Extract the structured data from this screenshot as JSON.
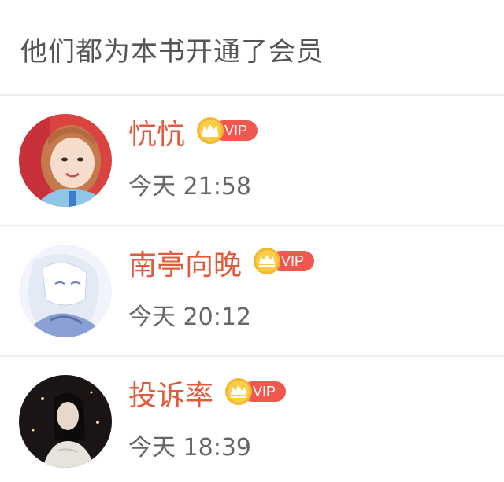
{
  "header": {
    "title": "他们都为本书开通了会员"
  },
  "members": [
    {
      "name": "忼忼",
      "badge": "VIP",
      "time": "今天 21:58"
    },
    {
      "name": "南亭向晚",
      "badge": "VIP",
      "time": "今天 20:12"
    },
    {
      "name": "投诉率",
      "badge": "VIP",
      "time": "今天 18:39"
    }
  ],
  "colors": {
    "name": "#e25a3c",
    "vip_pill": "#f0584f",
    "crown": "#f5b731",
    "divider": "#eeeeee"
  },
  "icons": [
    "crown-icon",
    "avatar"
  ]
}
